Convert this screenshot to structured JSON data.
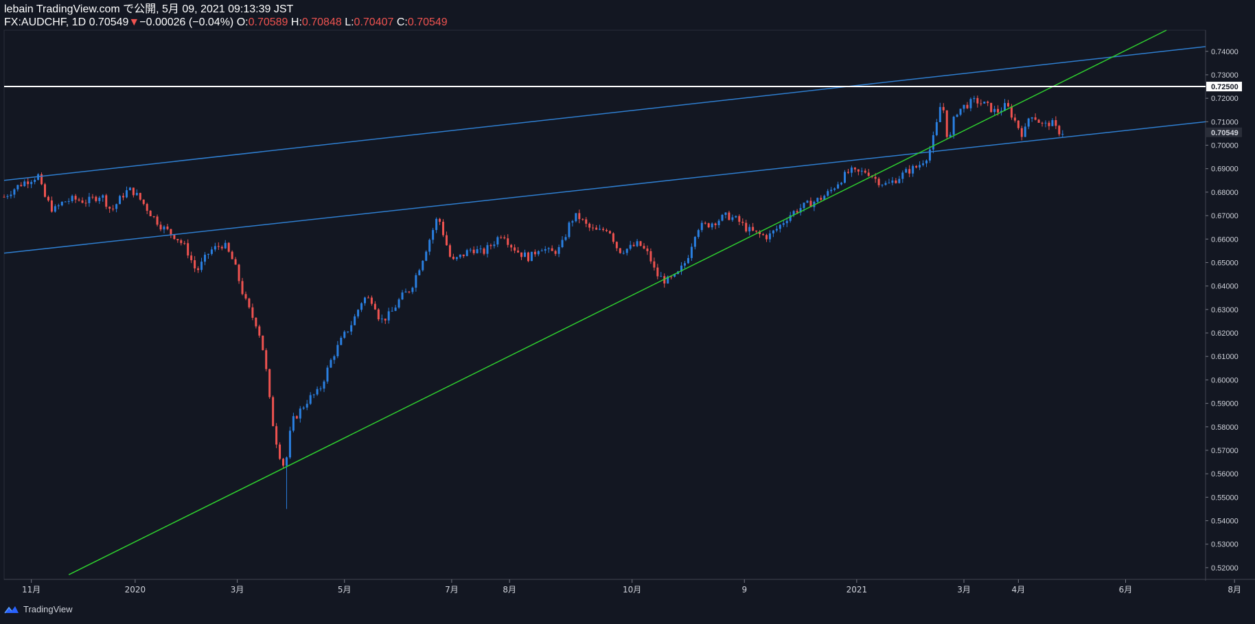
{
  "header": {
    "line1": "lebain TradingView.com で公開, 5月 09, 2021 09:13:39 JST",
    "symbol": "FX:AUDCHF, 1D",
    "last": "0.70549",
    "change_arrow": "▼",
    "change": "−0.00026 (−0.04%)",
    "o_label": "O:",
    "o_value": "0.70589",
    "h_label": "H:",
    "h_value": "0.70848",
    "l_label": "L:",
    "l_value": "0.70407",
    "c_label": "C:",
    "c_value": "0.70549"
  },
  "footer": {
    "brand": "TradingView",
    "logo_icon": "tradingview-logo-icon"
  },
  "colors": {
    "background": "#131722",
    "up": "#2a7fe0",
    "down": "#ef5350",
    "channel": "#2f7fd1",
    "trend": "#2fd12f",
    "resistance": "#ffffff",
    "axis_text": "#d1d4dc"
  },
  "chart_data": {
    "type": "candlestick",
    "symbol": "FX:AUDCHF",
    "interval": "1D",
    "ylim": [
      0.515,
      0.749
    ],
    "y_ticks": [
      "0.74000",
      "0.73000",
      "0.72500",
      "0.72000",
      "0.71000",
      "0.70549",
      "0.70000",
      "0.69000",
      "0.68000",
      "0.67000",
      "0.66000",
      "0.65000",
      "0.64000",
      "0.63000",
      "0.62000",
      "0.61000",
      "0.60000",
      "0.59000",
      "0.58000",
      "0.57000",
      "0.56000",
      "0.55000",
      "0.54000",
      "0.53000",
      "0.52000"
    ],
    "y_tick_values": [
      0.74,
      0.73,
      0.725,
      0.72,
      0.71,
      0.70549,
      0.7,
      0.69,
      0.68,
      0.67,
      0.66,
      0.65,
      0.64,
      0.63,
      0.62,
      0.61,
      0.6,
      0.59,
      0.58,
      0.57,
      0.56,
      0.55,
      0.54,
      0.53,
      0.52
    ],
    "highlighted_labels": {
      "0.72500": "resistance",
      "0.70549": "last"
    },
    "x_axis": [
      "11月",
      "2020",
      "3月",
      "5月",
      "7月",
      "8月",
      "10月",
      "9",
      "2021",
      "3月",
      "4月",
      "6月",
      "8月"
    ],
    "x_axis_days": [
      33,
      94,
      154,
      217,
      280,
      314,
      386,
      452,
      518,
      581,
      613,
      676,
      740
    ],
    "x_range_days": [
      17,
      723
    ],
    "grid": false,
    "legend": "none",
    "series_anchors": [
      {
        "day": 17,
        "price": 0.678
      },
      {
        "day": 22,
        "price": 0.681
      },
      {
        "day": 28,
        "price": 0.684
      },
      {
        "day": 37,
        "price": 0.687
      },
      {
        "day": 40,
        "price": 0.679
      },
      {
        "day": 46,
        "price": 0.672
      },
      {
        "day": 52,
        "price": 0.676
      },
      {
        "day": 58,
        "price": 0.677
      },
      {
        "day": 66,
        "price": 0.676
      },
      {
        "day": 74,
        "price": 0.679
      },
      {
        "day": 80,
        "price": 0.672
      },
      {
        "day": 88,
        "price": 0.68
      },
      {
        "day": 92,
        "price": 0.681
      },
      {
        "day": 98,
        "price": 0.676
      },
      {
        "day": 104,
        "price": 0.67
      },
      {
        "day": 110,
        "price": 0.665
      },
      {
        "day": 118,
        "price": 0.661
      },
      {
        "day": 124,
        "price": 0.656
      },
      {
        "day": 130,
        "price": 0.646
      },
      {
        "day": 138,
        "price": 0.655
      },
      {
        "day": 146,
        "price": 0.658
      },
      {
        "day": 152,
        "price": 0.65
      },
      {
        "day": 158,
        "price": 0.635
      },
      {
        "day": 162,
        "price": 0.628
      },
      {
        "day": 166,
        "price": 0.623
      },
      {
        "day": 170,
        "price": 0.61
      },
      {
        "day": 174,
        "price": 0.585
      },
      {
        "day": 178,
        "price": 0.57
      },
      {
        "day": 182,
        "price": 0.562
      },
      {
        "day": 186,
        "price": 0.582
      },
      {
        "day": 190,
        "price": 0.586
      },
      {
        "day": 196,
        "price": 0.592
      },
      {
        "day": 202,
        "price": 0.595
      },
      {
        "day": 210,
        "price": 0.61
      },
      {
        "day": 216,
        "price": 0.618
      },
      {
        "day": 222,
        "price": 0.625
      },
      {
        "day": 228,
        "price": 0.635
      },
      {
        "day": 234,
        "price": 0.634
      },
      {
        "day": 238,
        "price": 0.625
      },
      {
        "day": 244,
        "price": 0.628
      },
      {
        "day": 250,
        "price": 0.635
      },
      {
        "day": 256,
        "price": 0.639
      },
      {
        "day": 262,
        "price": 0.65
      },
      {
        "day": 268,
        "price": 0.662
      },
      {
        "day": 272,
        "price": 0.67
      },
      {
        "day": 276,
        "price": 0.66
      },
      {
        "day": 280,
        "price": 0.65
      },
      {
        "day": 286,
        "price": 0.653
      },
      {
        "day": 292,
        "price": 0.656
      },
      {
        "day": 298,
        "price": 0.654
      },
      {
        "day": 304,
        "price": 0.658
      },
      {
        "day": 310,
        "price": 0.663
      },
      {
        "day": 314,
        "price": 0.658
      },
      {
        "day": 320,
        "price": 0.654
      },
      {
        "day": 326,
        "price": 0.652
      },
      {
        "day": 332,
        "price": 0.657
      },
      {
        "day": 338,
        "price": 0.654
      },
      {
        "day": 344,
        "price": 0.656
      },
      {
        "day": 350,
        "price": 0.668
      },
      {
        "day": 354,
        "price": 0.67
      },
      {
        "day": 360,
        "price": 0.665
      },
      {
        "day": 366,
        "price": 0.663
      },
      {
        "day": 372,
        "price": 0.665
      },
      {
        "day": 378,
        "price": 0.655
      },
      {
        "day": 384,
        "price": 0.656
      },
      {
        "day": 390,
        "price": 0.658
      },
      {
        "day": 396,
        "price": 0.653
      },
      {
        "day": 400,
        "price": 0.645
      },
      {
        "day": 406,
        "price": 0.642
      },
      {
        "day": 412,
        "price": 0.644
      },
      {
        "day": 418,
        "price": 0.651
      },
      {
        "day": 424,
        "price": 0.665
      },
      {
        "day": 430,
        "price": 0.666
      },
      {
        "day": 436,
        "price": 0.668
      },
      {
        "day": 442,
        "price": 0.67
      },
      {
        "day": 448,
        "price": 0.668
      },
      {
        "day": 454,
        "price": 0.664
      },
      {
        "day": 460,
        "price": 0.662
      },
      {
        "day": 466,
        "price": 0.661
      },
      {
        "day": 472,
        "price": 0.665
      },
      {
        "day": 478,
        "price": 0.67
      },
      {
        "day": 484,
        "price": 0.673
      },
      {
        "day": 490,
        "price": 0.675
      },
      {
        "day": 496,
        "price": 0.677
      },
      {
        "day": 502,
        "price": 0.68
      },
      {
        "day": 508,
        "price": 0.685
      },
      {
        "day": 514,
        "price": 0.689
      },
      {
        "day": 518,
        "price": 0.688
      },
      {
        "day": 524,
        "price": 0.689
      },
      {
        "day": 530,
        "price": 0.685
      },
      {
        "day": 536,
        "price": 0.683
      },
      {
        "day": 542,
        "price": 0.686
      },
      {
        "day": 548,
        "price": 0.689
      },
      {
        "day": 554,
        "price": 0.691
      },
      {
        "day": 560,
        "price": 0.696
      },
      {
        "day": 564,
        "price": 0.705
      },
      {
        "day": 568,
        "price": 0.72
      },
      {
        "day": 572,
        "price": 0.7
      },
      {
        "day": 576,
        "price": 0.714
      },
      {
        "day": 582,
        "price": 0.717
      },
      {
        "day": 588,
        "price": 0.719
      },
      {
        "day": 594,
        "price": 0.717
      },
      {
        "day": 600,
        "price": 0.714
      },
      {
        "day": 606,
        "price": 0.717
      },
      {
        "day": 612,
        "price": 0.709
      },
      {
        "day": 616,
        "price": 0.704
      },
      {
        "day": 620,
        "price": 0.714
      },
      {
        "day": 624,
        "price": 0.711
      },
      {
        "day": 628,
        "price": 0.708
      },
      {
        "day": 632,
        "price": 0.71
      },
      {
        "day": 636,
        "price": 0.706
      },
      {
        "day": 640,
        "price": 0.7055
      }
    ],
    "wicks": [
      {
        "day": 183,
        "low": 0.545
      }
    ],
    "lines": [
      {
        "name": "upper-channel",
        "color": "#2f7fd1",
        "points": [
          [
            17,
            0.685
          ],
          [
            723,
            0.742
          ]
        ]
      },
      {
        "name": "lower-channel",
        "color": "#2f7fd1",
        "points": [
          [
            17,
            0.654
          ],
          [
            723,
            0.71
          ]
        ]
      },
      {
        "name": "uptrend",
        "color": "#2fd12f",
        "points": [
          [
            55,
            0.517
          ],
          [
            700,
            0.749
          ]
        ]
      },
      {
        "name": "resistance",
        "color": "#ffffff",
        "points": [
          [
            17,
            0.725
          ],
          [
            723,
            0.725
          ]
        ]
      }
    ]
  }
}
